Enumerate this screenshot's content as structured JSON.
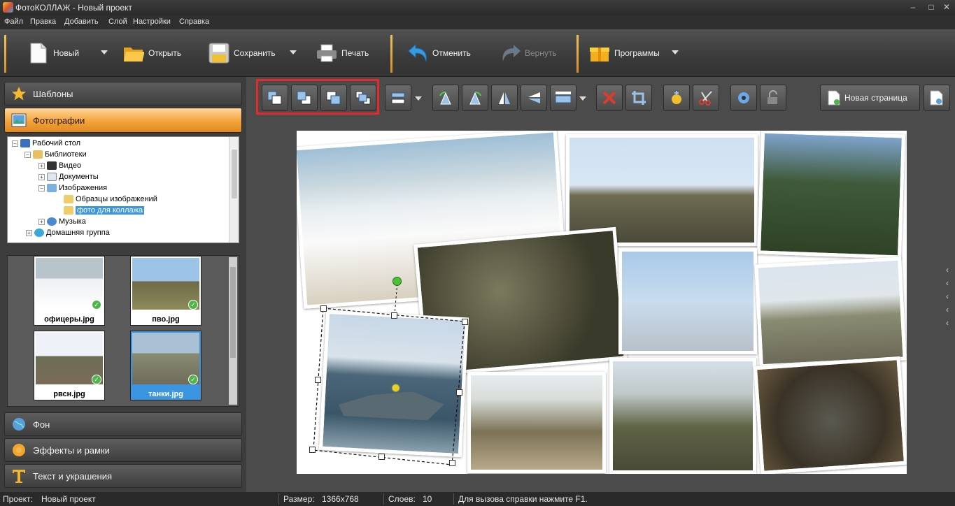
{
  "window": {
    "title": "ФотоКОЛЛАЖ - Новый проект"
  },
  "menu": [
    "Файл",
    "Правка",
    "Добавить",
    "Слой",
    "Настройки",
    "Справка"
  ],
  "toolbar": {
    "new_label": "Новый",
    "open_label": "Открыть",
    "save_label": "Сохранить",
    "print_label": "Печать",
    "undo_label": "Отменить",
    "redo_label": "Вернуть",
    "programs_label": "Программы"
  },
  "left_panel": {
    "templates_label": "Шаблоны",
    "photos_label": "Фотографии",
    "background_label": "Фон",
    "effects_label": "Эффекты и рамки",
    "text_label": "Текст и украшения"
  },
  "tree": [
    {
      "label": "Рабочий стол"
    },
    {
      "label": "Библиотеки"
    },
    {
      "label": "Видео"
    },
    {
      "label": "Документы"
    },
    {
      "label": "Изображения"
    },
    {
      "label": "Образцы изображений"
    },
    {
      "label": "фото для коллажа"
    },
    {
      "label": "Музыка"
    },
    {
      "label": "Домашняя группа"
    }
  ],
  "thumbnails": [
    {
      "caption": "офицеры.jpg",
      "selected": false
    },
    {
      "caption": "пво.jpg",
      "selected": false
    },
    {
      "caption": "рвсн.jpg",
      "selected": false
    },
    {
      "caption": "танки.jpg",
      "selected": true
    }
  ],
  "editor": {
    "new_page_label": "Новая страница"
  },
  "status": {
    "project_label": "Проект:",
    "project_value": "Новый проект",
    "size_label": "Размер:",
    "size_value": "1366x768",
    "layers_label": "Слоев:",
    "layers_value": "10",
    "help_text": "Для вызова справки нажмите F1."
  },
  "colors": {
    "accent": "#f3a33b",
    "highlight": "#e42a2a",
    "selection": "#3b95e0"
  }
}
